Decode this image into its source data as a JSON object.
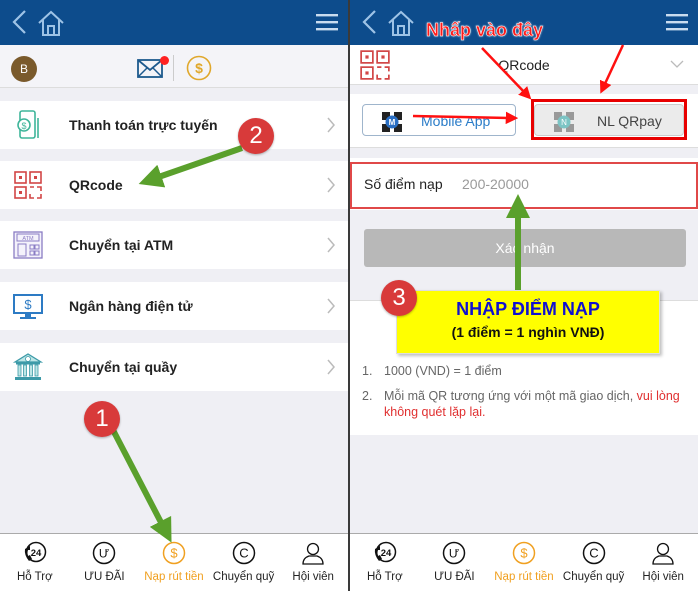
{
  "left": {
    "avatar_letter": "B",
    "menu_items": [
      {
        "label": "Thanh toán trực tuyến",
        "icon": "mobile-payment-icon"
      },
      {
        "label": "QRcode",
        "icon": "qrcode-icon"
      },
      {
        "label": "Chuyển tại ATM",
        "icon": "atm-icon"
      },
      {
        "label": "Ngân hàng điện tử",
        "icon": "ebanking-monitor-icon"
      },
      {
        "label": "Chuyển tại quầy",
        "icon": "bank-counter-icon"
      }
    ],
    "atm_icon_text": "ATM"
  },
  "right": {
    "method_title": "QRcode",
    "pay_options": [
      {
        "label": "Mobile App",
        "badge": "M"
      },
      {
        "label": "NL QRpay",
        "badge": "N"
      }
    ],
    "amount_label": "Số điểm nạp",
    "amount_placeholder": "200-20000",
    "amount_value": "",
    "confirm_label": "Xác nhận",
    "notes": [
      {
        "num": "1.",
        "text": "1000 (VND) = 1 điểm",
        "warn": ""
      },
      {
        "num": "2.",
        "text": "Mỗi mã QR tương ứng với một mã giao dịch, ",
        "warn": "vui lòng không quét lặp lại."
      }
    ]
  },
  "tabbar": {
    "active_index": 2,
    "tabs": [
      {
        "label": "Hỗ Trợ",
        "icon": "support-24-icon",
        "glyph": "24"
      },
      {
        "label": "ƯU ĐÃI",
        "icon": "promo-icon",
        "glyph": "Ư"
      },
      {
        "label": "Nạp rút tiền",
        "icon": "deposit-icon",
        "glyph": "$"
      },
      {
        "label": "Chuyển quỹ",
        "icon": "transfer-icon",
        "glyph": "C"
      },
      {
        "label": "Hội viên",
        "icon": "member-icon",
        "glyph": ""
      }
    ]
  },
  "annotations": {
    "step1": "1",
    "step2": "2",
    "step3": "3",
    "click_here": "Nhấp vào đây",
    "callout_title": "NHẬP ĐIỂM NẠP",
    "callout_sub": "(1 điểm = 1 nghìn VNĐ)"
  },
  "colors": {
    "header": "#0d4c8c",
    "active_tab": "#f0a020",
    "highlight": "#e80000",
    "arrow_green": "#5aa02c",
    "callout_bg": "#ffff00"
  }
}
